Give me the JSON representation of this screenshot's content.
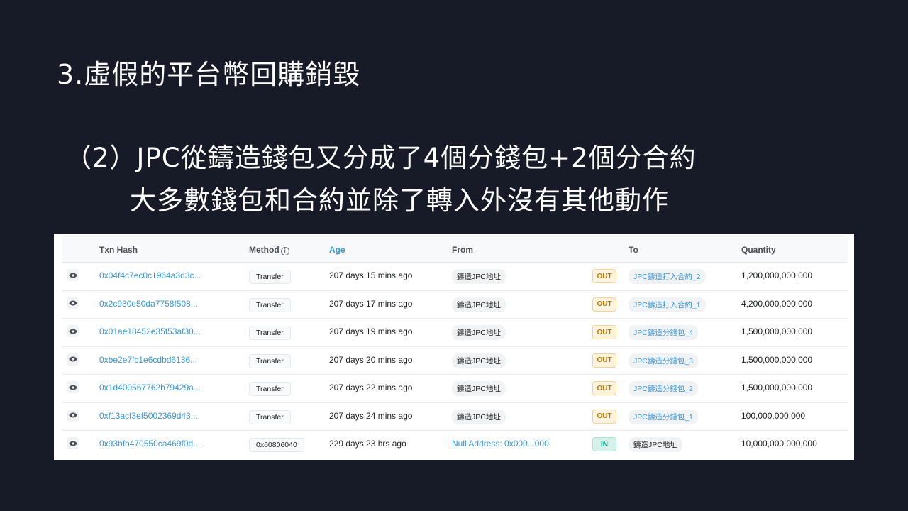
{
  "slide": {
    "title": "3.虛假的平台幣回購銷毀",
    "subtitle_line1": "（2）JPC從鑄造錢包又分成了4個分錢包+2個分合約",
    "subtitle_line2": "大多數錢包和合約並除了轉入外沒有其他動作"
  },
  "table": {
    "headers": {
      "txn_hash": "Txn Hash",
      "method": "Method",
      "age": "Age",
      "from": "From",
      "to": "To",
      "quantity": "Quantity"
    },
    "rows": [
      {
        "hash": "0x04f4c7ec0c1964a3d3c...",
        "method": "Transfer",
        "age": "207 days 15 mins ago",
        "from": "鑄造JPC地址",
        "direction": "OUT",
        "to": "JPC鑄造打入合約_2",
        "quantity": "1,200,000,000,000"
      },
      {
        "hash": "0x2c930e50da7758f508...",
        "method": "Transfer",
        "age": "207 days 17 mins ago",
        "from": "鑄造JPC地址",
        "direction": "OUT",
        "to": "JPC鑄造打入合約_1",
        "quantity": "4,200,000,000,000"
      },
      {
        "hash": "0x01ae18452e35f53af30...",
        "method": "Transfer",
        "age": "207 days 19 mins ago",
        "from": "鑄造JPC地址",
        "direction": "OUT",
        "to": "JPC鑄造分錢包_4",
        "quantity": "1,500,000,000,000"
      },
      {
        "hash": "0xbe2e7fc1e6cdbd6136...",
        "method": "Transfer",
        "age": "207 days 20 mins ago",
        "from": "鑄造JPC地址",
        "direction": "OUT",
        "to": "JPC鑄造分錢包_3",
        "quantity": "1,500,000,000,000"
      },
      {
        "hash": "0x1d400567762b79429a...",
        "method": "Transfer",
        "age": "207 days 22 mins ago",
        "from": "鑄造JPC地址",
        "direction": "OUT",
        "to": "JPC鑄造分錢包_2",
        "quantity": "1,500,000,000,000"
      },
      {
        "hash": "0xf13acf3ef5002369d43...",
        "method": "Transfer",
        "age": "207 days 24 mins ago",
        "from": "鑄造JPC地址",
        "direction": "OUT",
        "to": "JPC鑄造分錢包_1",
        "quantity": "100,000,000,000"
      },
      {
        "hash": "0x93bfb470550ca469f0d...",
        "method": "0x60806040",
        "age": "229 days 23 hrs ago",
        "from": "Null Address: 0x000...000",
        "from_is_link": true,
        "direction": "IN",
        "to": "鑄造JPC地址",
        "to_is_link": false,
        "quantity": "10,000,000,000,000"
      }
    ]
  },
  "colors": {
    "background": "#171a27",
    "link": "#3598dc",
    "out_badge": "#b47d00",
    "in_badge": "#00a186"
  },
  "icons": {
    "row_action": "eye-icon",
    "method_info": "info-icon"
  }
}
